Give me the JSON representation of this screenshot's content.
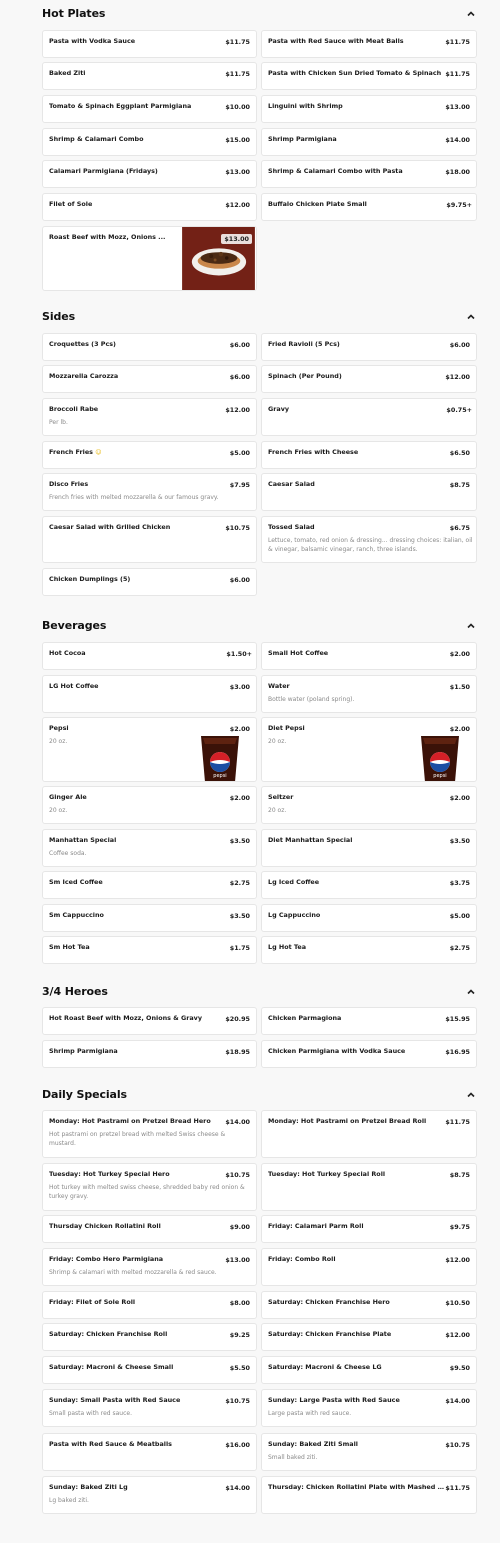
{
  "sections": {
    "hot_plates": {
      "title": "Hot Plates",
      "items": [
        {
          "name": "Pasta with Vodka Sauce",
          "price": "$11.75"
        },
        {
          "name": "Pasta with Red Sauce with Meat Balls",
          "price": "$11.75"
        },
        {
          "name": "Baked Ziti",
          "price": "$11.75"
        },
        {
          "name": "Pasta with Chicken Sun Dried Tomato & Spinach",
          "price": "$11.75"
        },
        {
          "name": "Tomato & Spinach Eggplant Parmigiana",
          "price": "$10.00"
        },
        {
          "name": "Linguini with Shrimp",
          "price": "$13.00"
        },
        {
          "name": "Shrimp & Calamari Combo",
          "price": "$15.00"
        },
        {
          "name": "Shrimp Parmigiana",
          "price": "$14.00"
        },
        {
          "name": "Calamari Parmigiana (Fridays)",
          "price": "$13.00"
        },
        {
          "name": "Shrimp & Calamari Combo with Pasta",
          "price": "$18.00"
        },
        {
          "name": "Filet of Sole",
          "price": "$12.00"
        },
        {
          "name": "Buffalo Chicken Plate Small",
          "price": "$9.75+"
        },
        {
          "name": "Roast Beef with Mozz, Onions ...",
          "price": "$13.00"
        }
      ]
    },
    "sides": {
      "title": "Sides",
      "items": [
        {
          "name": "Croquettes (3 Pcs)",
          "price": "$6.00"
        },
        {
          "name": "Fried Ravioli (5 Pcs)",
          "price": "$6.00"
        },
        {
          "name": "Mozzarella Carozza",
          "price": "$6.00"
        },
        {
          "name": "Spinach (Per Pound)",
          "price": "$12.00"
        },
        {
          "name": "Broccoli Rabe",
          "price": "$12.00",
          "desc": "Per lb."
        },
        {
          "name": "Gravy",
          "price": "$0.75+"
        },
        {
          "name": "French Fries",
          "price": "$5.00",
          "emoji": "☺"
        },
        {
          "name": "French Fries with Cheese",
          "price": "$6.50"
        },
        {
          "name": "Disco Fries",
          "price": "$7.95",
          "desc": "French fries with melted mozzarella & our famous gravy."
        },
        {
          "name": "Caesar Salad",
          "price": "$8.75"
        },
        {
          "name": "Caesar Salad with Grilled Chicken",
          "price": "$10.75"
        },
        {
          "name": "Tossed Salad",
          "price": "$6.75",
          "desc": "Lettuce, tomato, red onion & dressing... dressing choices: italian, oil & vinegar, balsamic vinegar, ranch, three islands."
        },
        {
          "name": "Chicken Dumplings (5)",
          "price": "$6.00"
        }
      ]
    },
    "beverages": {
      "title": "Beverages",
      "items": [
        {
          "name": "Hot Cocoa",
          "price": "$1.50+"
        },
        {
          "name": "Small Hot Coffee",
          "price": "$2.00"
        },
        {
          "name": "LG Hot Coffee",
          "price": "$3.00"
        },
        {
          "name": "Water",
          "price": "$1.50",
          "desc": "Bottle water (poland spring)."
        },
        {
          "name": "Pepsi",
          "price": "$2.00",
          "desc": "20 oz."
        },
        {
          "name": "Diet Pepsi",
          "price": "$2.00",
          "desc": "20 oz."
        },
        {
          "name": "Ginger Ale",
          "price": "$2.00",
          "desc": "20 oz."
        },
        {
          "name": "Seltzer",
          "price": "$2.00",
          "desc": "20 oz."
        },
        {
          "name": "Manhattan Special",
          "price": "$3.50",
          "desc": "Coffee soda."
        },
        {
          "name": "Diet Manhattan Special",
          "price": "$3.50"
        },
        {
          "name": "Sm Iced Coffee",
          "price": "$2.75"
        },
        {
          "name": "Lg Iced Coffee",
          "price": "$3.75"
        },
        {
          "name": "Sm Cappuccino",
          "price": "$3.50"
        },
        {
          "name": "Lg Cappuccino",
          "price": "$5.00"
        },
        {
          "name": "Sm Hot Tea",
          "price": "$1.75"
        },
        {
          "name": "Lg Hot Tea",
          "price": "$2.75"
        }
      ]
    },
    "heroes": {
      "title": "3/4 Heroes",
      "items": [
        {
          "name": "Hot Roast Beef with Mozz, Onions & Gravy",
          "price": "$20.95"
        },
        {
          "name": "Chicken Parmagiona",
          "price": "$15.95"
        },
        {
          "name": "Shrimp Parmigiana",
          "price": "$18.95"
        },
        {
          "name": "Chicken Parmigiana with Vodka Sauce",
          "price": "$16.95"
        }
      ]
    },
    "specials": {
      "title": "Daily Specials",
      "items": [
        {
          "name": "Monday: Hot Pastrami on Pretzel Bread Hero",
          "price": "$14.00",
          "desc": "Hot pastrami on pretzel bread with melted Swiss cheese & mustard."
        },
        {
          "name": "Monday: Hot Pastrami on Pretzel Bread Roll",
          "price": "$11.75"
        },
        {
          "name": "Tuesday: Hot Turkey Special Hero",
          "price": "$10.75",
          "desc": "Hot turkey with melted swiss cheese, shredded baby red onion & turkey gravy."
        },
        {
          "name": "Tuesday: Hot Turkey Special Roll",
          "price": "$8.75"
        },
        {
          "name": "Thursday Chicken Rollatini Roll",
          "price": "$9.00"
        },
        {
          "name": "Friday: Calamari Parm Roll",
          "price": "$9.75"
        },
        {
          "name": "Friday: Combo Hero Parmigiana",
          "price": "$13.00",
          "desc": "Shrimp & calamari with melted mozzarella & red sauce."
        },
        {
          "name": "Friday: Combo Roll",
          "price": "$12.00"
        },
        {
          "name": "Friday: Filet of Sole Roll",
          "price": "$8.00"
        },
        {
          "name": "Saturday: Chicken Franchise Hero",
          "price": "$10.50"
        },
        {
          "name": "Saturday: Chicken Franchise Roll",
          "price": "$9.25"
        },
        {
          "name": "Saturday: Chicken Franchise Plate",
          "price": "$12.00"
        },
        {
          "name": "Saturday: Macroni & Cheese Small",
          "price": "$5.50"
        },
        {
          "name": "Saturday: Macroni & Cheese LG",
          "price": "$9.50"
        },
        {
          "name": "Sunday: Small Pasta with Red Sauce",
          "price": "$10.75",
          "desc": "Small pasta with red sauce."
        },
        {
          "name": "Sunday: Large Pasta with Red Sauce",
          "price": "$14.00",
          "desc": "Large pasta with red sauce."
        },
        {
          "name": "Pasta with Red Sauce & Meatballs",
          "price": "$16.00"
        },
        {
          "name": "Sunday: Baked Ziti Small",
          "price": "$10.75",
          "desc": "Small baked ziti."
        },
        {
          "name": "Sunday: Baked Ziti Lg",
          "price": "$14.00",
          "desc": "Lg baked ziti."
        },
        {
          "name": "Thursday: Chicken Rollatini Plate with Mashed Pot...",
          "price": "$11.75"
        }
      ]
    }
  },
  "icons": {
    "collapse": "chevron-up-icon",
    "pepsi": "pepsi-cup-image",
    "roast_beef": "roast-beef-sandwich-image"
  }
}
